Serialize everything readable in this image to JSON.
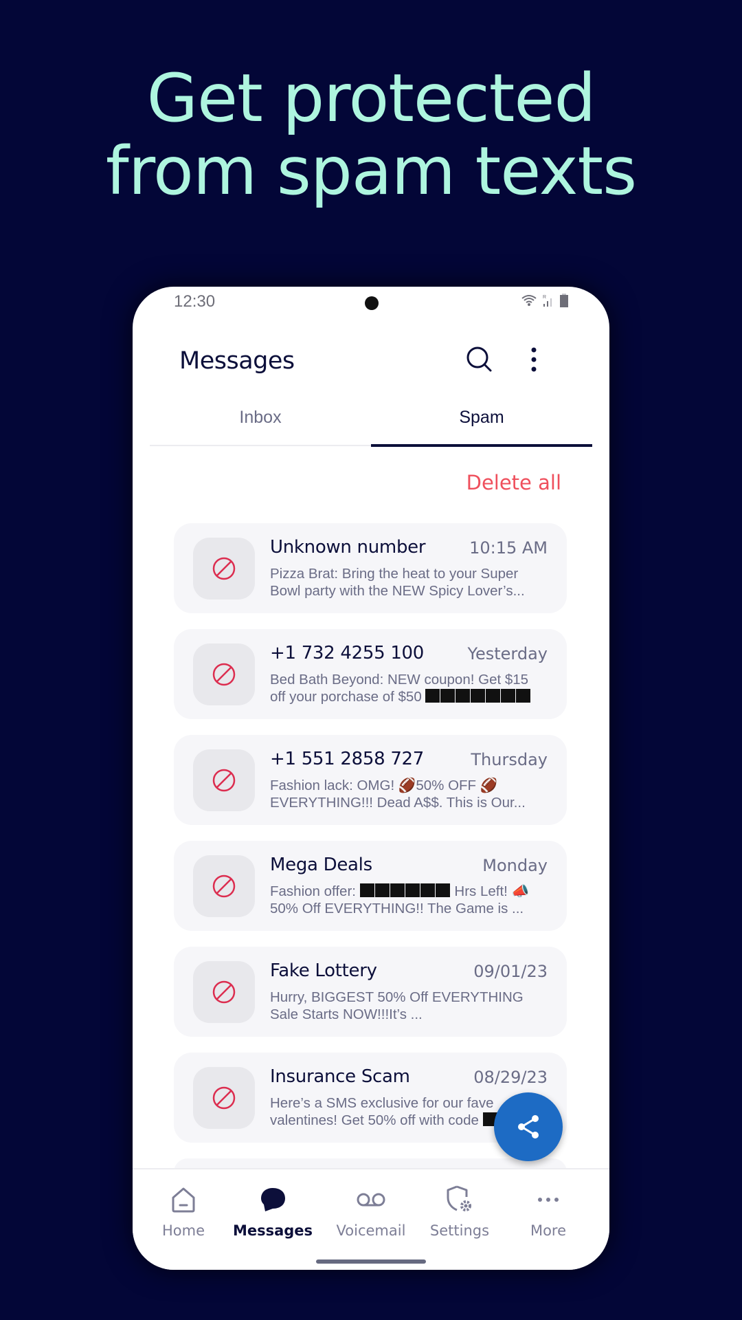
{
  "promo": {
    "headline_line1": "Get protected",
    "headline_line2": "from spam texts"
  },
  "status_bar": {
    "time": "12:30",
    "icons": [
      "wifi-icon",
      "signal-icon",
      "battery-icon"
    ],
    "roaming_indicator": "R"
  },
  "app_bar": {
    "title": "Messages",
    "actions": [
      "search-icon",
      "more-vert-icon"
    ]
  },
  "tabs": [
    {
      "label": "Inbox",
      "selected": false
    },
    {
      "label": "Spam",
      "selected": true
    }
  ],
  "delete_all_label": "Delete all",
  "messages": [
    {
      "sender": "Unknown number",
      "date": "10:15 AM",
      "preview_line1": "Pizza Brat: Bring the heat to your Super",
      "preview_line2": "Bowl party with the NEW Spicy Lover’s..."
    },
    {
      "sender": "+1 732 4255 100",
      "date": "Yesterday",
      "preview_line1": "Bed Bath Beyond: NEW coupon! Get $15",
      "preview_line2": "off your porchase of $50",
      "redacted_blocks": 7
    },
    {
      "sender": "+1 551 2858 727",
      "date": "Thursday",
      "preview_line1": "Fashion lack: OMG! 🏈50% OFF 🏈",
      "preview_line2": "EVERYTHING!!! Dead A$$. This is Our..."
    },
    {
      "sender": "Mega Deals",
      "date": "Monday",
      "preview_line1_a": "Fashion offer:",
      "redacted_blocks": 6,
      "preview_line1_b": "Hrs Left! 📣",
      "preview_line2": "50% Off EVERYTHING!! The Game is ..."
    },
    {
      "sender": "Fake Lottery",
      "date": "09/01/23",
      "preview_line1": "Hurry, BIGGEST 50% Off EVERYTHING",
      "preview_line2": "Sale Starts NOW!!!It’s ..."
    },
    {
      "sender": "Insurance Scam",
      "date": "08/29/23",
      "preview_line1": "Here’s a SMS exclusive for our fave",
      "preview_line2": "valentines! Get 50% off with code"
    }
  ],
  "fab": {
    "icon": "share-icon"
  },
  "bottom_nav": [
    {
      "label": "Home",
      "icon": "home-icon",
      "active": false
    },
    {
      "label": "Messages",
      "icon": "message-bubble-icon",
      "active": true
    },
    {
      "label": "Voicemail",
      "icon": "voicemail-icon",
      "active": false
    },
    {
      "label": "Settings",
      "icon": "shield-gear-icon",
      "active": false
    },
    {
      "label": "More",
      "icon": "more-horiz-icon",
      "active": false
    }
  ],
  "colors": {
    "background": "#030637",
    "headline": "#aef5df",
    "accent_red": "#ef4f5c",
    "fab_blue": "#1d6bc4",
    "text_dark": "#0c0f3a"
  }
}
